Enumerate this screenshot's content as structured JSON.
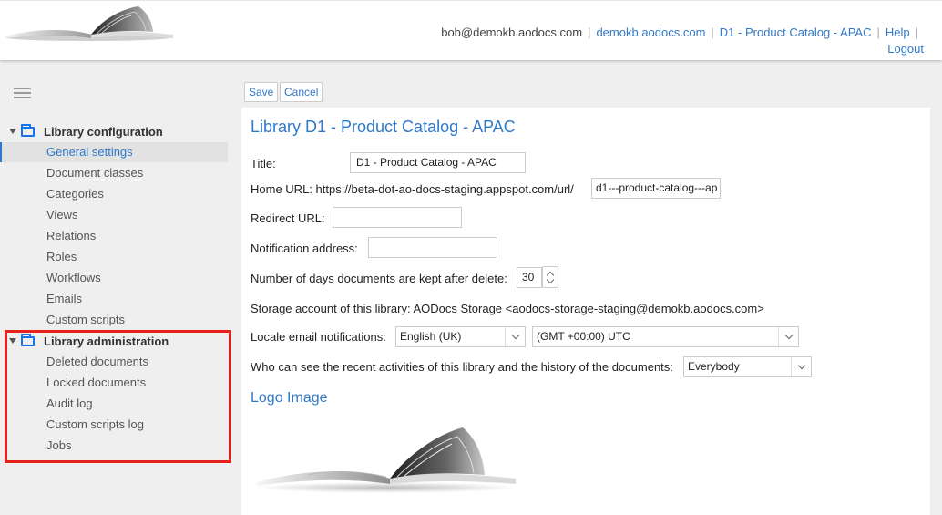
{
  "header": {
    "user_email": "bob@demokb.aodocs.com",
    "domain_link": "demokb.aodocs.com",
    "library_link": "D1 - Product Catalog - APAC",
    "help_link": "Help",
    "logout_link": "Logout",
    "logo_icon": "open-book-logo"
  },
  "sidebar": {
    "menu_icon": "hamburger-menu-icon",
    "config_title": "Library configuration",
    "config_items": [
      {
        "label": "General settings",
        "active": true
      },
      {
        "label": "Document classes"
      },
      {
        "label": "Categories"
      },
      {
        "label": "Views"
      },
      {
        "label": "Relations"
      },
      {
        "label": "Roles"
      },
      {
        "label": "Workflows"
      },
      {
        "label": "Emails"
      },
      {
        "label": "Custom scripts"
      }
    ],
    "admin_title": "Library administration",
    "admin_items": [
      {
        "label": "Deleted documents"
      },
      {
        "label": "Locked documents"
      },
      {
        "label": "Audit log"
      },
      {
        "label": "Custom scripts log"
      },
      {
        "label": "Jobs"
      }
    ],
    "highlight_color": "#e8221a"
  },
  "toolbar": {
    "save_label": "Save",
    "cancel_label": "Cancel"
  },
  "main": {
    "page_title": "Library D1 - Product Catalog - APAC",
    "title_label": "Title:",
    "title_value": "D1 - Product Catalog - APAC",
    "home_url_label": "Home URL: https://beta-dot-ao-docs-staging.appspot.com/url/",
    "home_url_value": "d1---product-catalog---ap",
    "redirect_url_label": "Redirect URL:",
    "redirect_url_value": "",
    "notification_label": "Notification address:",
    "notification_value": "",
    "days_label": "Number of days documents are kept after delete:",
    "days_value": "30",
    "storage_text": "Storage account of this library: AODocs Storage <aodocs-storage-staging@demokb.aodocs.com>",
    "locale_label": "Locale email notifications:",
    "locale_value": "English (UK)",
    "timezone_value": "(GMT +00:00) UTC",
    "activity_label": "Who can see the recent activities of this library and the history of the documents:",
    "activity_value": "Everybody",
    "logo_section_title": "Logo Image"
  },
  "colors": {
    "accent": "#2e79c9",
    "folder_icon": "#1a73e8"
  }
}
